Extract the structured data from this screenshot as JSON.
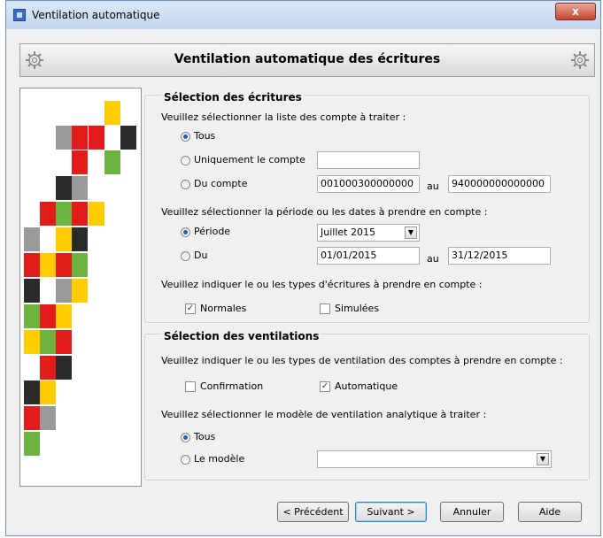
{
  "window": {
    "title": "Ventilation automatique",
    "close_label": "x"
  },
  "header": {
    "title": "Ventilation automatique des écritures"
  },
  "colors": {
    "red": "#e21b1b",
    "yellow": "#ffcc00",
    "green": "#6cb33f",
    "dark": "#2b2b2b",
    "gray": "#9a9a9a"
  },
  "section_ecritures": {
    "title": "Sélection des écritures",
    "accounts_prompt": "Veuillez sélectionner la liste des compte à traiter :",
    "opt_tous": "Tous",
    "opt_uniquement": "Uniquement le compte",
    "uniquement_value": "",
    "opt_du_compte": "Du compte",
    "compte_from": "001000300000000",
    "au_label": "au",
    "compte_to": "940000000000000",
    "period_prompt": "Veuillez sélectionner la période ou les dates à prendre en compte :",
    "opt_periode": "Période",
    "periode_value": "Juillet 2015",
    "opt_du": "Du",
    "date_from": "01/01/2015",
    "au_label2": "au",
    "date_to": "31/12/2015",
    "types_prompt": "Veuillez indiquer le ou les types d'écritures à prendre en compte :",
    "chk_normales": "Normales",
    "chk_simulees": "Simulées",
    "check_mark": "✓"
  },
  "section_ventilations": {
    "title": "Sélection des ventilations",
    "types_prompt": "Veuillez indiquer le ou les types de ventilation des comptes à prendre en compte :",
    "chk_confirmation": "Confirmation",
    "chk_automatique": "Automatique",
    "model_prompt": "Veuillez sélectionner le modèle de ventilation analytique à traiter :",
    "opt_tous": "Tous",
    "opt_modele": "Le modèle",
    "modele_value": "",
    "check_mark": "✓"
  },
  "buttons": {
    "precedent": "< Précédent",
    "suivant": "Suivant >",
    "annuler": "Annuler",
    "aide": "Aide"
  }
}
